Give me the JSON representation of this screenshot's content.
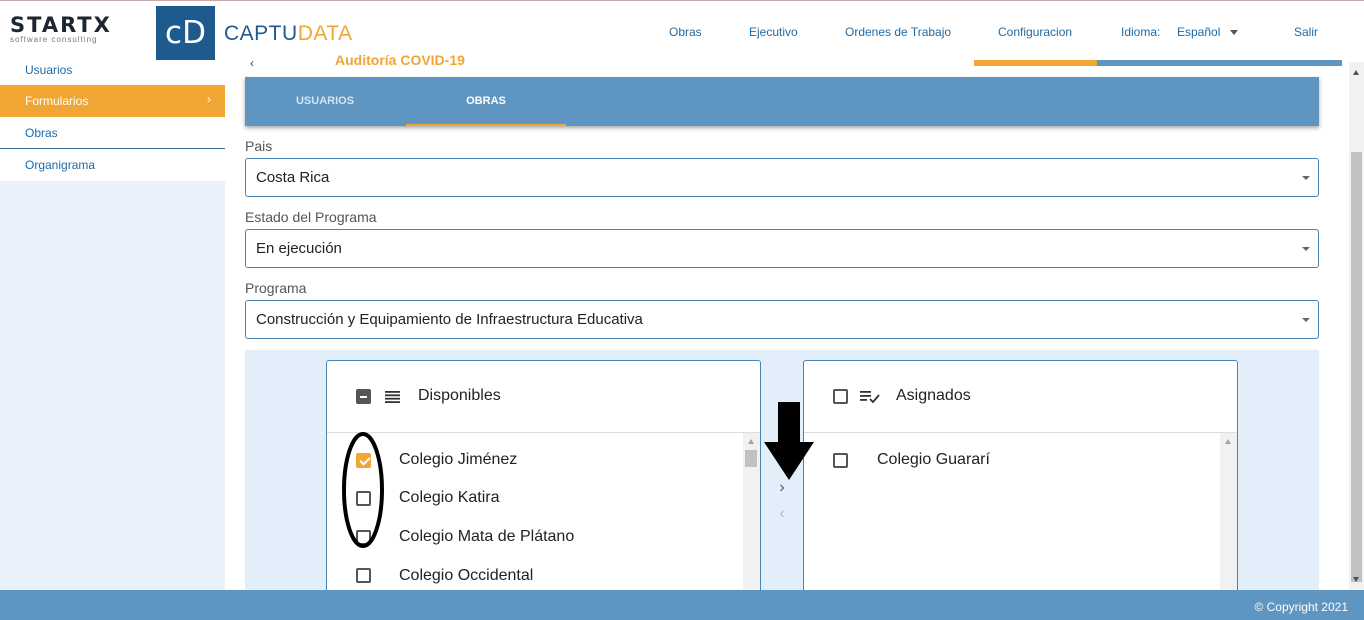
{
  "header": {
    "logo_startx": "STARTX",
    "logo_startx_tagline": "software consulting",
    "logo_cd": "cD",
    "logo_captu_a": "CAPTU",
    "logo_captu_b": "DATA",
    "nav": {
      "obras": "Obras",
      "ejecutivo": "Ejecutivo",
      "ordenes": "Ordenes de Trabajo",
      "configuracion": "Configuracion",
      "idioma_label": "Idioma:",
      "idioma_value": "Español",
      "salir": "Salir"
    }
  },
  "sidebar": {
    "items": [
      {
        "label": "Usuarios"
      },
      {
        "label": "Formularios"
      },
      {
        "label": "Obras"
      },
      {
        "label": "Organigrama"
      }
    ],
    "chevron": "›"
  },
  "page": {
    "partial_title": "Auditoría COVID-19",
    "back_arrow": "‹"
  },
  "tabs": {
    "usuarios": "USUARIOS",
    "obras": "OBRAS",
    "active": "OBRAS"
  },
  "form": {
    "pais_label": "Pais",
    "pais_value": "Costa Rica",
    "estado_label": "Estado del Programa",
    "estado_value": "En ejecución",
    "programa_label": "Programa",
    "programa_value": "Construcción y Equipamiento de Infraestructura Educativa"
  },
  "disponibles": {
    "title": "Disponibles",
    "items": [
      {
        "label": "Colegio Jiménez",
        "checked": true
      },
      {
        "label": "Colegio Katira",
        "checked": false
      },
      {
        "label": "Colegio Mata de Plátano",
        "checked": false
      },
      {
        "label": "Colegio Occidental",
        "checked": false
      }
    ]
  },
  "asignados": {
    "title": "Asignados",
    "items": [
      {
        "label": "Colegio Guararí",
        "checked": false
      }
    ]
  },
  "transfer": {
    "right": "›",
    "left": "‹"
  },
  "footer": {
    "copyright": "© Copyright 2021"
  },
  "colors": {
    "brand_blue": "#1f5a8e",
    "accent_orange": "#f0a632",
    "bar_blue": "#5e95c1"
  }
}
